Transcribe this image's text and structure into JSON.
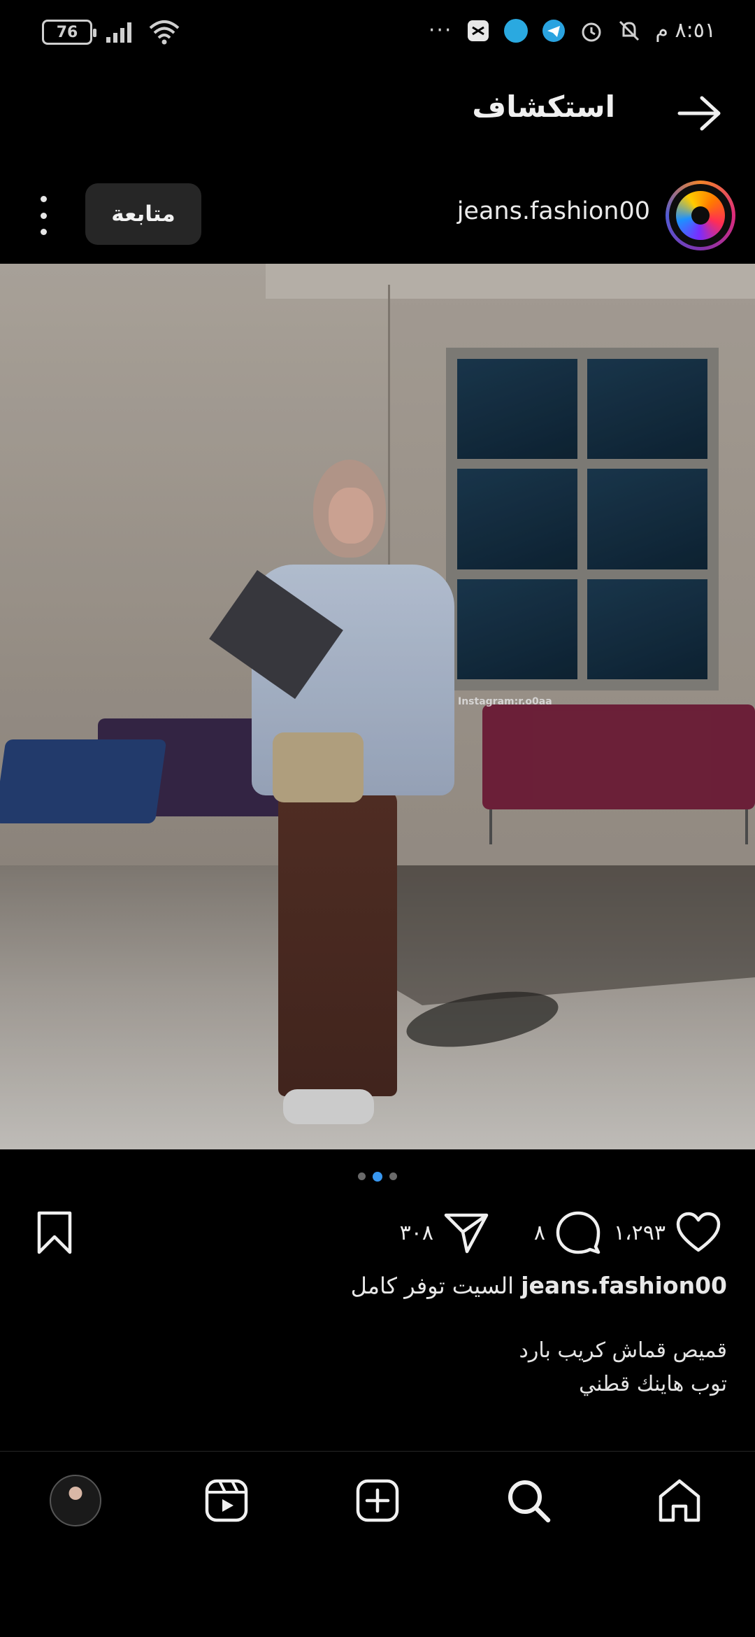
{
  "status_bar": {
    "battery": "76",
    "time": "٨:٥١ م",
    "overflow": "···"
  },
  "header": {
    "title": "استكشاف",
    "back_icon": "arrow-right-icon"
  },
  "post": {
    "username": "jeans.fashion00",
    "follow_label": "متابعة",
    "watermark": "Instagram:r.o0aa",
    "carousel": {
      "count": 3,
      "active_index": 1
    },
    "likes": "١،٢٩٣",
    "comments": "٨",
    "shares": "٣٠٨"
  },
  "caption": {
    "username": "jeans.fashion00",
    "text": "السيت توفر كامل",
    "line2": "قميص قماش كريب بارد",
    "line3": "توب هاينك قطني"
  },
  "colors": {
    "background": "#000000",
    "accent": "#3897f0",
    "follow_bg": "#262626"
  },
  "bottom_nav": {
    "items": [
      "profile-avatar",
      "reels-icon",
      "create-icon",
      "search-icon",
      "home-icon"
    ]
  }
}
